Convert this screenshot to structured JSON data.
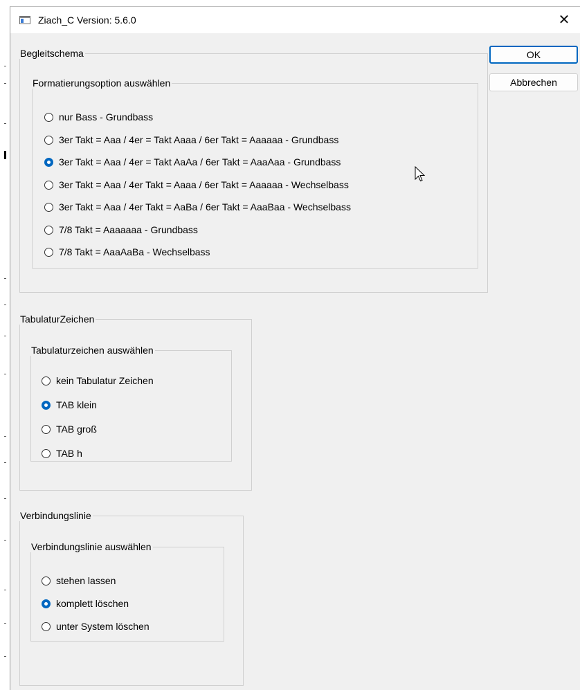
{
  "window": {
    "title": "Ziach_C  Version: 5.6.0",
    "close_glyph": "✕",
    "icon": "app-window-icon"
  },
  "buttons": {
    "ok": "OK",
    "cancel": "Abbrechen"
  },
  "begleitschema": {
    "title": "Begleitschema",
    "subgroup_title": "Formatierungsoption auswählen",
    "options": [
      {
        "label": "nur Bass - Grundbass",
        "checked": false
      },
      {
        "label": "3er Takt = Aaa / 4er = Takt Aaaa / 6er Takt = Aaaaaa - Grundbass",
        "checked": false
      },
      {
        "label": "3er Takt = Aaa / 4er = Takt AaAa / 6er Takt = AaaAaa - Grundbass",
        "checked": true
      },
      {
        "label": "3er Takt = Aaa / 4er Takt = Aaaa / 6er Takt = Aaaaaa - Wechselbass",
        "checked": false
      },
      {
        "label": "3er Takt = Aaa / 4er Takt = AaBa / 6er Takt = AaaBaa - Wechselbass",
        "checked": false
      },
      {
        "label": "7/8 Takt = Aaaaaaa - Grundbass",
        "checked": false
      },
      {
        "label": "7/8 Takt = AaaAaBa - Wechselbass",
        "checked": false
      }
    ]
  },
  "tabulatur": {
    "title": "TabulaturZeichen",
    "subgroup_title": "Tabulaturzeichen auswählen",
    "options": [
      {
        "label": "kein Tabulatur Zeichen",
        "checked": false
      },
      {
        "label": "TAB klein",
        "checked": true
      },
      {
        "label": "TAB groß",
        "checked": false
      },
      {
        "label": "TAB h",
        "checked": false
      }
    ]
  },
  "verbindungslinie": {
    "title": "Verbindungslinie",
    "subgroup_title": "Verbindungslinie auswählen",
    "options": [
      {
        "label": "stehen lassen",
        "checked": false
      },
      {
        "label": "komplett löschen",
        "checked": true
      },
      {
        "label": "unter System löschen",
        "checked": false
      }
    ]
  },
  "colors": {
    "accent": "#0067c0",
    "dialog_bg": "#f0f0f0",
    "titlebar_bg": "#ffffff"
  }
}
